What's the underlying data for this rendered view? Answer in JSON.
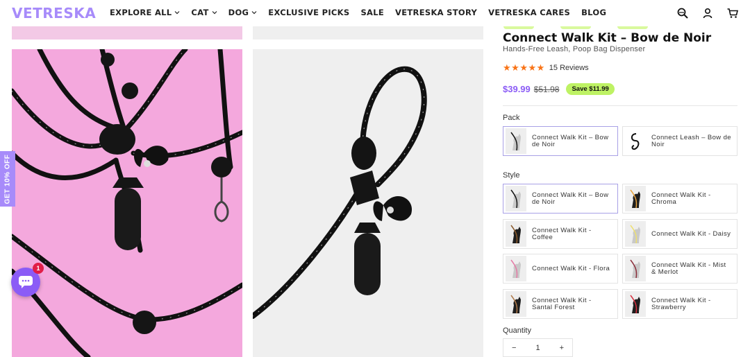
{
  "brand": {
    "logo": "VETRESKA",
    "accent": "#a78bfa"
  },
  "nav": {
    "items": [
      {
        "label": "EXPLORE ALL",
        "dropdown": true
      },
      {
        "label": "CAT",
        "dropdown": true
      },
      {
        "label": "DOG",
        "dropdown": true
      },
      {
        "label": "EXCLUSIVE PICKS",
        "dropdown": false
      },
      {
        "label": "SALE",
        "dropdown": false
      },
      {
        "label": "VETRESKA STORY",
        "dropdown": false
      },
      {
        "label": "VETRESKA CARES",
        "dropdown": false
      },
      {
        "label": "BLOG",
        "dropdown": false
      }
    ],
    "icons": [
      "search-icon",
      "account-icon",
      "cart-icon"
    ]
  },
  "side_tab": {
    "label": "GET 10% OFF"
  },
  "chat": {
    "badge_count": "1"
  },
  "product": {
    "title": "Connect Walk Kit – Bow de Noir",
    "subtitle": "Hands-Free Leash, Poop Bag Dispenser",
    "rating": 5,
    "reviews": "15 Reviews",
    "price": "$39.99",
    "compare_price": "$51.98",
    "save": "Save $11.99",
    "pack_label": "Pack",
    "pack_options": [
      {
        "label": "Connect Walk Kit – Bow de Noir",
        "selected": true
      },
      {
        "label": "Connect Leash – Bow de Noir",
        "selected": false
      }
    ],
    "style_label": "Style",
    "style_options": [
      {
        "label": "Connect Walk Kit – Bow de Noir",
        "selected": true
      },
      {
        "label": "Connect Walk Kit - Chroma",
        "selected": false
      },
      {
        "label": "Connect Walk Kit - Coffee",
        "selected": false
      },
      {
        "label": "Connect Walk Kit - Daisy",
        "selected": false
      },
      {
        "label": "Connect Walk Kit - Flora",
        "selected": false
      },
      {
        "label": "Connect Walk Kit - Mist & Merlot",
        "selected": false
      },
      {
        "label": "Connect Walk Kit - Santal Forest",
        "selected": false
      },
      {
        "label": "Connect Walk Kit - Strawberry",
        "selected": false
      }
    ],
    "quantity_label": "Quantity",
    "quantity_minus": "−",
    "quantity_value": "1",
    "quantity_plus": "+"
  }
}
